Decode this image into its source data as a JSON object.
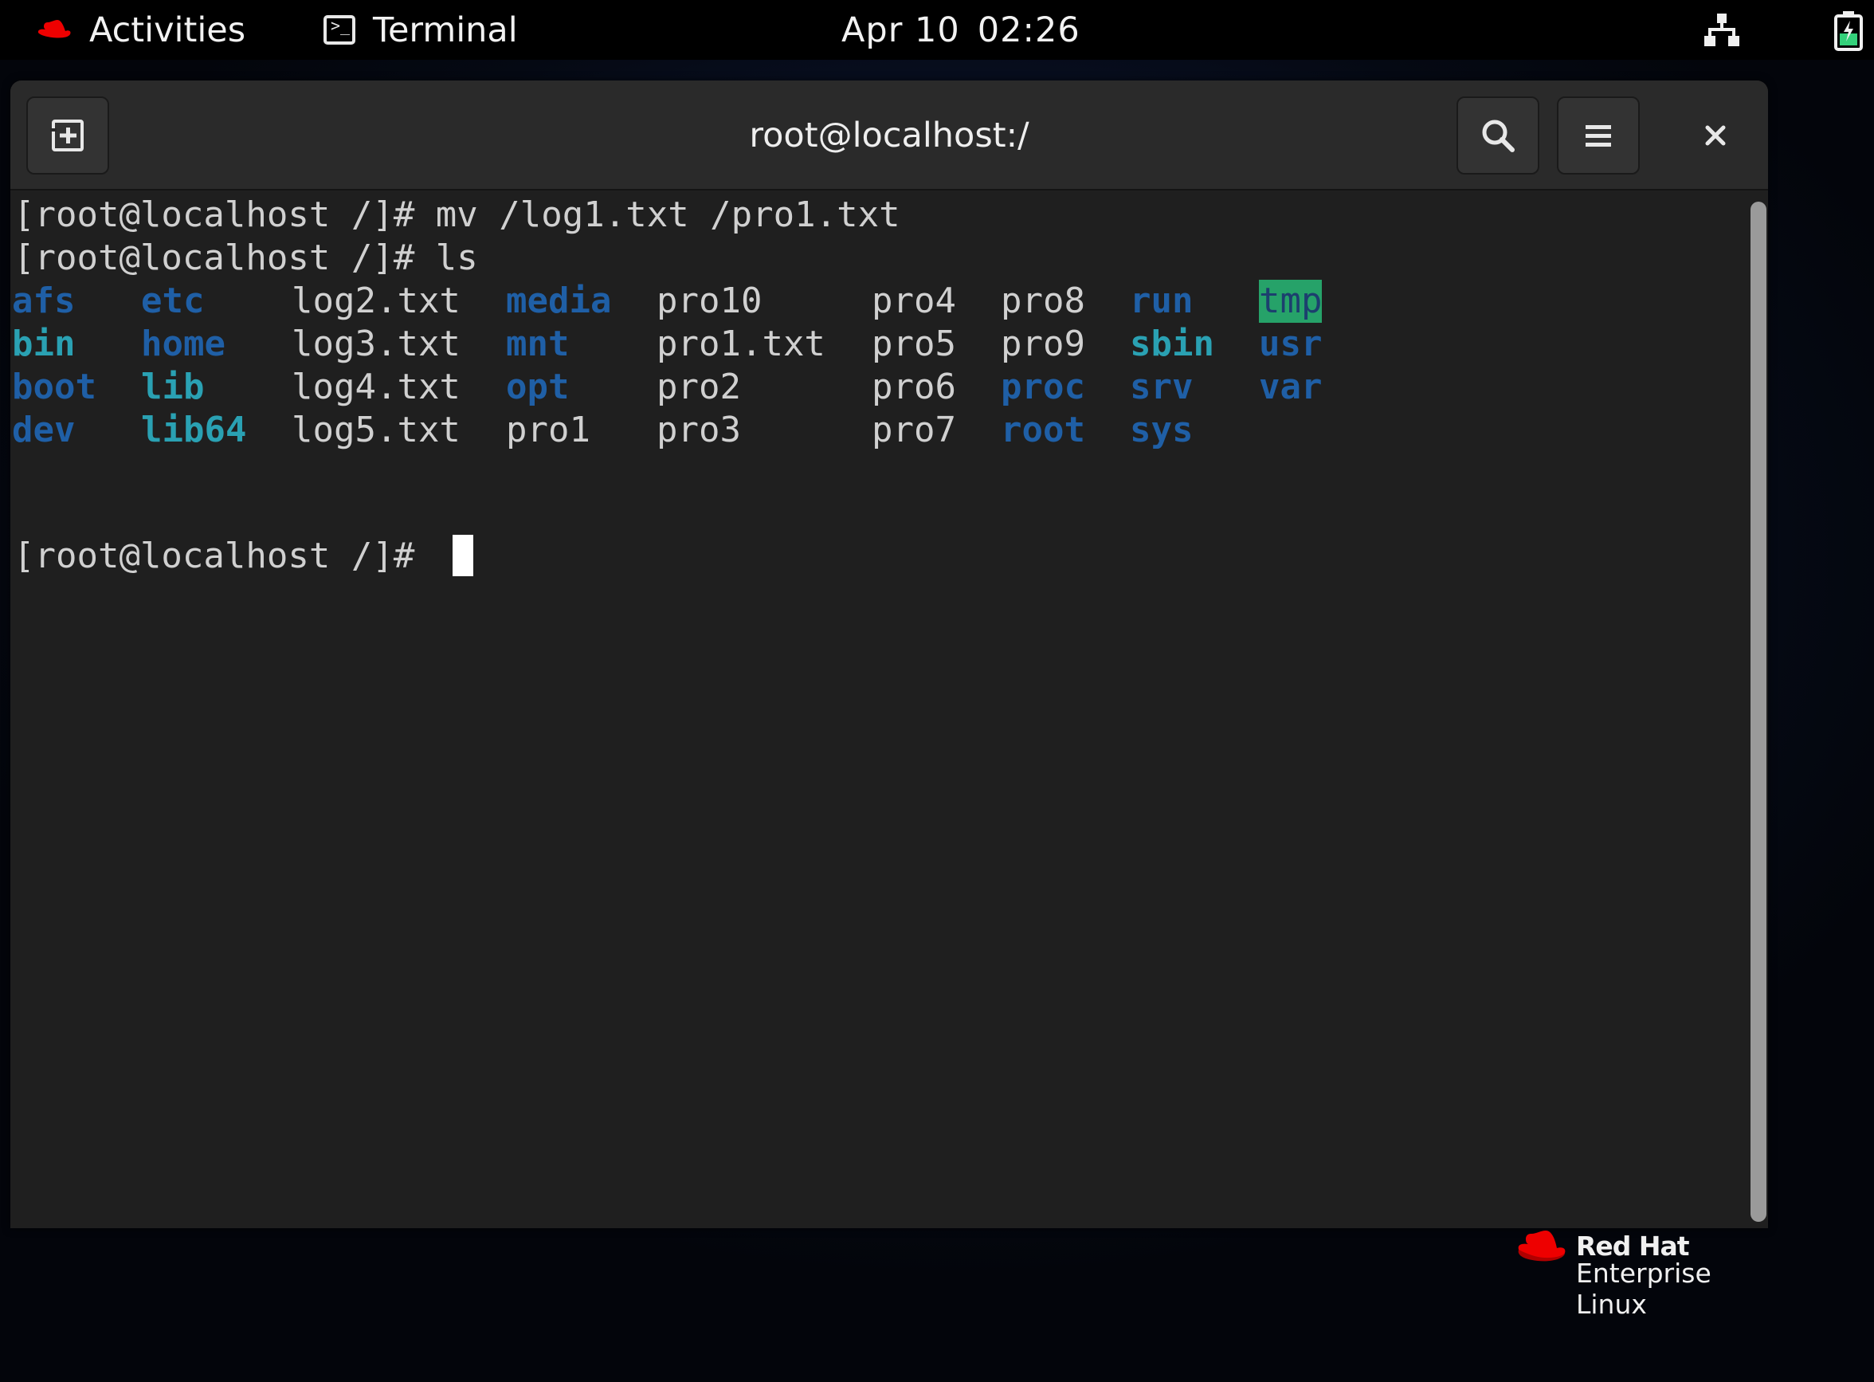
{
  "topbar": {
    "activities": "Activities",
    "app_name": "Terminal",
    "date": "Apr 10",
    "time": "02:26"
  },
  "window": {
    "title": "root@localhost:/",
    "buttons": {
      "new_tab": "new-tab-icon",
      "search": "search-icon",
      "menu": "hamburger-menu-icon",
      "close": "close-icon"
    }
  },
  "terminal": {
    "lines": [
      "[root@localhost /]# mv /log1.txt /pro1.txt",
      "[root@localhost /]# ls"
    ],
    "prompt": "[root@localhost /]# ",
    "ls_grid": [
      [
        {
          "text": "afs",
          "kind": "dir"
        },
        {
          "text": "etc",
          "kind": "dir"
        },
        {
          "text": "log2.txt",
          "kind": "file"
        },
        {
          "text": "media",
          "kind": "dir"
        },
        {
          "text": "pro10",
          "kind": "file"
        },
        {
          "text": "pro4",
          "kind": "file"
        },
        {
          "text": "pro8",
          "kind": "file"
        },
        {
          "text": "run",
          "kind": "dir"
        },
        {
          "text": "tmp",
          "kind": "tmp"
        }
      ],
      [
        {
          "text": "bin",
          "kind": "link"
        },
        {
          "text": "home",
          "kind": "dir"
        },
        {
          "text": "log3.txt",
          "kind": "file"
        },
        {
          "text": "mnt",
          "kind": "dir"
        },
        {
          "text": "pro1.txt",
          "kind": "file"
        },
        {
          "text": "pro5",
          "kind": "file"
        },
        {
          "text": "pro9",
          "kind": "file"
        },
        {
          "text": "sbin",
          "kind": "link"
        },
        {
          "text": "usr",
          "kind": "dir"
        }
      ],
      [
        {
          "text": "boot",
          "kind": "dir"
        },
        {
          "text": "lib",
          "kind": "link"
        },
        {
          "text": "log4.txt",
          "kind": "file"
        },
        {
          "text": "opt",
          "kind": "dir"
        },
        {
          "text": "pro2",
          "kind": "file"
        },
        {
          "text": "pro6",
          "kind": "file"
        },
        {
          "text": "proc",
          "kind": "dir"
        },
        {
          "text": "srv",
          "kind": "dir"
        },
        {
          "text": "var",
          "kind": "dir"
        }
      ],
      [
        {
          "text": "dev",
          "kind": "dir"
        },
        {
          "text": "lib64",
          "kind": "link"
        },
        {
          "text": "log5.txt",
          "kind": "file"
        },
        {
          "text": "pro1",
          "kind": "file"
        },
        {
          "text": "pro3",
          "kind": "file"
        },
        {
          "text": "pro7",
          "kind": "file"
        },
        {
          "text": "root",
          "kind": "dir"
        },
        {
          "text": "sys",
          "kind": "dir"
        }
      ]
    ]
  },
  "logo": {
    "line1": "Red Hat",
    "line2": "Enterprise Linux"
  },
  "colors": {
    "directory": "#1f5fa6",
    "symlink": "#2aa1b3",
    "sticky_dir_bg": "#26a269",
    "text": "#d0d0d0",
    "redhat_red": "#ee0000"
  }
}
